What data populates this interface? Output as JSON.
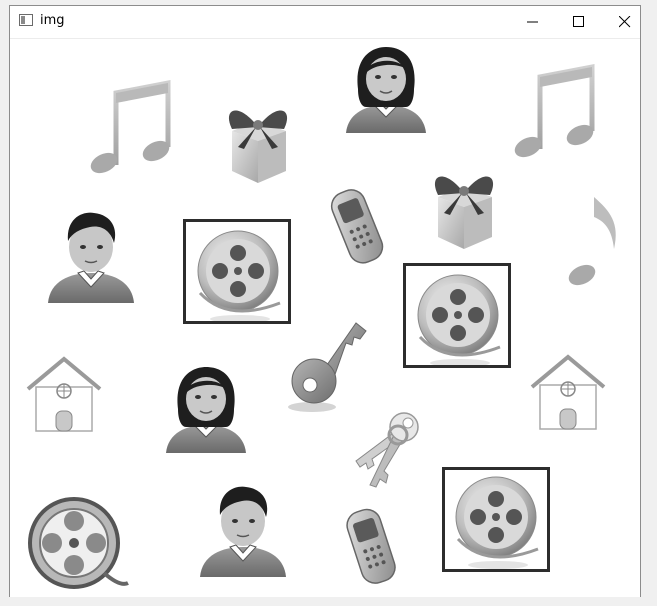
{
  "window": {
    "title": "img",
    "controls": [
      "minimize",
      "maximize",
      "close"
    ]
  },
  "canvas": {
    "background": "#ffffff",
    "sprites": [
      {
        "kind": "music-note",
        "icon": "music-note-icon"
      },
      {
        "kind": "gift",
        "icon": "gift-icon"
      },
      {
        "kind": "girl",
        "icon": "girl-avatar-icon"
      },
      {
        "kind": "music-note",
        "icon": "music-note-icon"
      },
      {
        "kind": "boy",
        "icon": "boy-avatar-icon"
      },
      {
        "kind": "film-reel",
        "icon": "film-reel-icon",
        "selected": true
      },
      {
        "kind": "cell-phone",
        "icon": "cell-phone-icon"
      },
      {
        "kind": "gift",
        "icon": "gift-icon"
      },
      {
        "kind": "film-reel",
        "icon": "film-reel-icon",
        "selected": true
      },
      {
        "kind": "music-note",
        "icon": "music-note-icon"
      },
      {
        "kind": "house",
        "icon": "house-icon"
      },
      {
        "kind": "girl",
        "icon": "girl-avatar-icon"
      },
      {
        "kind": "key",
        "icon": "key-icon"
      },
      {
        "kind": "house",
        "icon": "house-icon"
      },
      {
        "kind": "keys",
        "icon": "keys-icon"
      },
      {
        "kind": "film-reel",
        "icon": "film-reel-icon"
      },
      {
        "kind": "boy",
        "icon": "boy-avatar-icon"
      },
      {
        "kind": "cell-phone",
        "icon": "cell-phone-icon"
      },
      {
        "kind": "film-reel",
        "icon": "film-reel-icon",
        "selected": true
      }
    ],
    "selection_color": "#2d2d2d"
  }
}
